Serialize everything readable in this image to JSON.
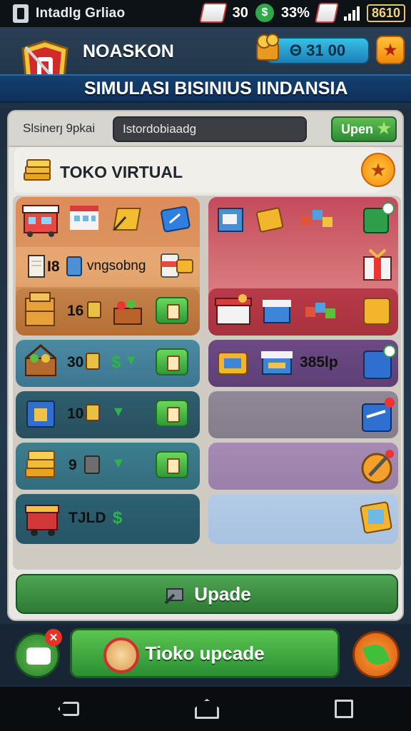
{
  "status_bar": {
    "app_title": "Intadlg Grliao",
    "level": "30",
    "percent": "33%",
    "battery": "8610"
  },
  "header": {
    "team_name": "NOASKON",
    "gold_amount": "Θ 31 00",
    "subtitle": "SIMULASI BISINIUS IINDANSIA"
  },
  "search": {
    "label": "Slsinerȷ 9pkai",
    "value": "Istordobiaadg",
    "button_label": "Upen"
  },
  "section": {
    "title": "TOKO VIRTUAL"
  },
  "cells": {
    "r2_text": "I8",
    "r2_text2": "vngsobng",
    "r3_value": "16",
    "r4_value": "30",
    "r4_right_value": "385lp",
    "r5_value": "10",
    "r6_value": "9",
    "r7_value": "TJLD"
  },
  "actions": {
    "upgrade_label": "Upade",
    "shop_upgrade_label": "Tioko upcade"
  },
  "colors": {
    "accent_green": "#2fb34a",
    "accent_orange": "#f08a0a",
    "accent_red": "#d32f2f"
  }
}
